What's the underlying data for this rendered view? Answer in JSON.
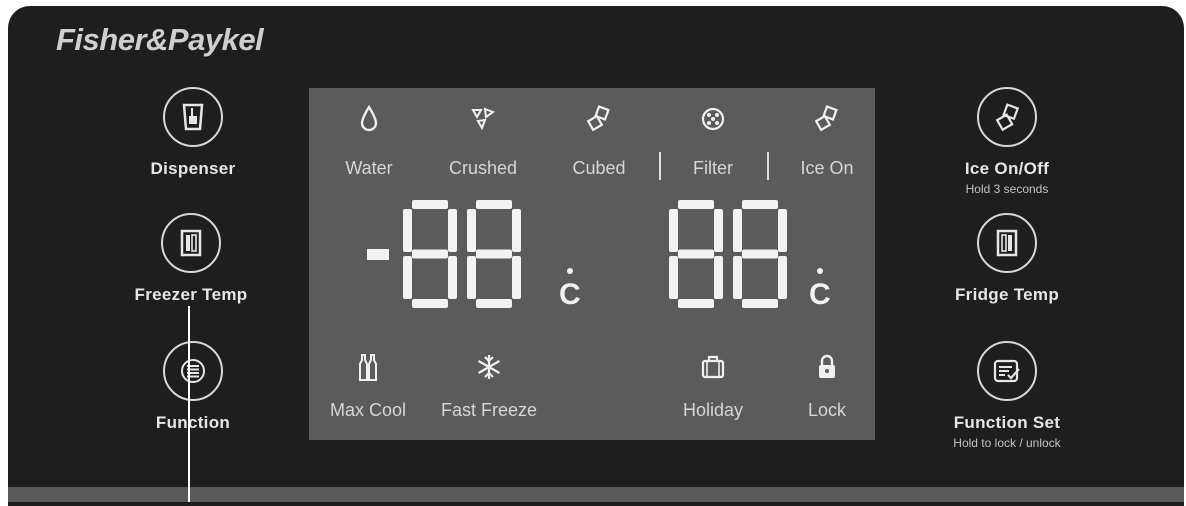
{
  "brand": "Fisher&Paykel",
  "left_buttons": [
    {
      "label": "Dispenser",
      "icon": "glass-icon"
    },
    {
      "label": "Freezer Temp",
      "icon": "freezer-door-icon"
    },
    {
      "label": "Function",
      "icon": "menu-lines-icon"
    }
  ],
  "right_buttons": [
    {
      "label": "Ice On/Off",
      "sub": "Hold 3 seconds",
      "icon": "ice-cube-icon"
    },
    {
      "label": "Fridge Temp",
      "icon": "fridge-door-icon"
    },
    {
      "label": "Function Set",
      "sub": "Hold to lock / unlock",
      "icon": "checklist-icon"
    }
  ],
  "display": {
    "top_items": [
      {
        "label": "Water",
        "icon": "water-drop-icon"
      },
      {
        "label": "Crushed",
        "icon": "crushed-ice-icon"
      },
      {
        "label": "Cubed",
        "icon": "ice-cube-icon"
      },
      {
        "label": "Filter",
        "icon": "filter-icon"
      },
      {
        "label": "Ice On",
        "icon": "ice-cube-icon"
      }
    ],
    "freezer_readout": "-88",
    "freezer_unit": "C",
    "fridge_readout": "88",
    "fridge_unit": "C",
    "bottom_items": [
      {
        "label": "Max Cool",
        "icon": "bottles-icon"
      },
      {
        "label": "Fast Freeze",
        "icon": "snowflake-icon"
      },
      {
        "label": "Holiday",
        "icon": "suitcase-icon"
      },
      {
        "label": "Lock",
        "icon": "padlock-icon"
      }
    ]
  },
  "colors": {
    "panel": "#1e1e1e",
    "lcd": "#5b5b5b",
    "segment": "#f2f2f2",
    "text": "#e6e6e6"
  }
}
